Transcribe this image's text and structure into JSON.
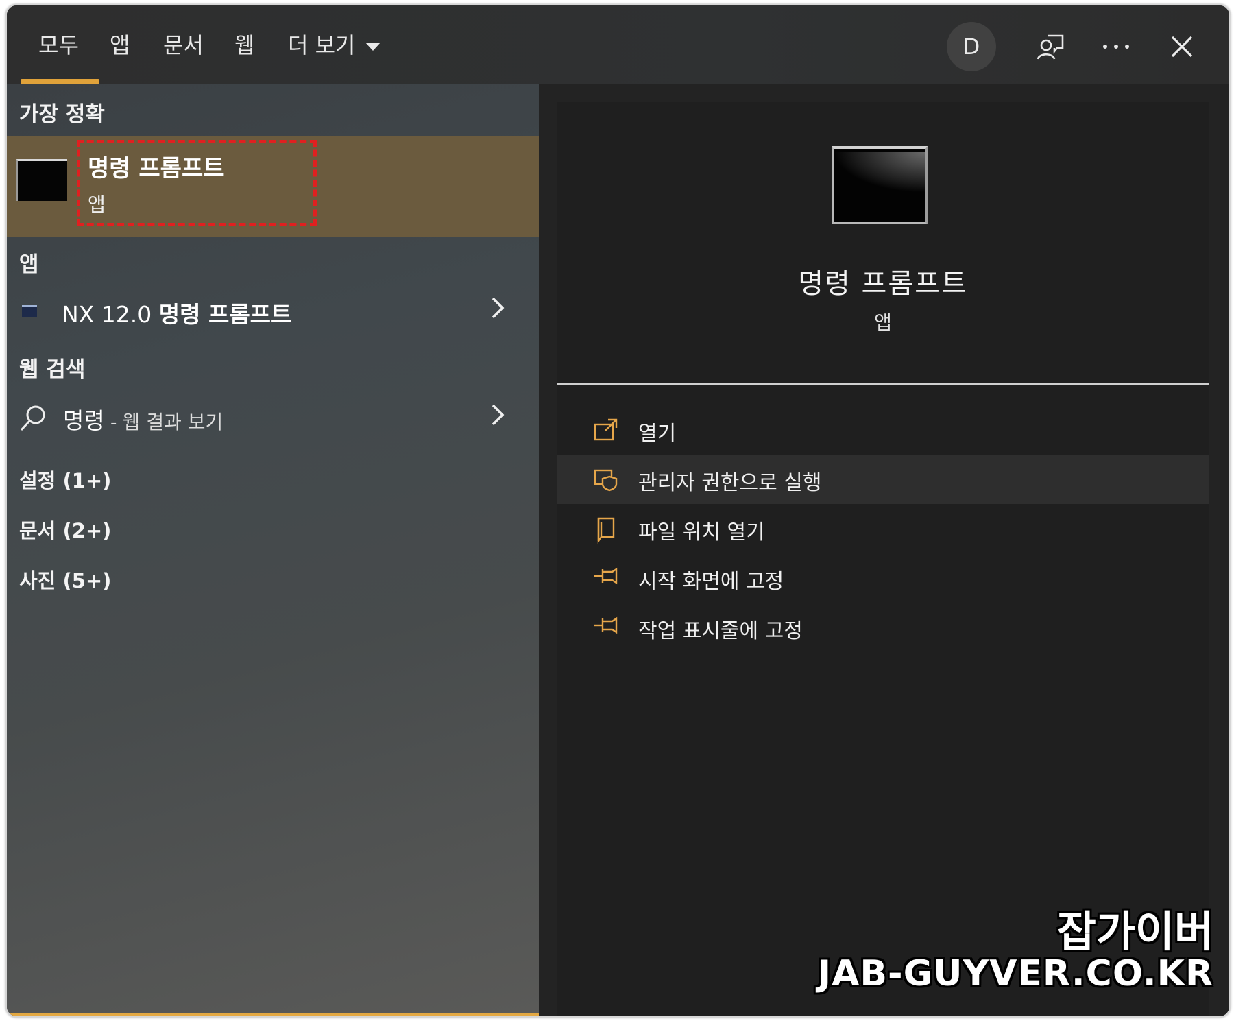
{
  "tabs": {
    "all": "모두",
    "apps": "앱",
    "docs": "문서",
    "web": "웹",
    "more": "더 보기"
  },
  "header": {
    "avatar_letter": "D",
    "feedback_icon": "feedback-person-icon",
    "more_icon": "ellipsis-icon",
    "close_icon": "close-icon",
    "accent_color": "#e0a23a"
  },
  "left": {
    "best_match_heading": "가장 정확",
    "best_match": {
      "title": "명령 프롬프트",
      "subtitle": "앱",
      "highlight_color": "#6b5b3e",
      "annotation_color": "#e02020"
    },
    "apps_heading": "앱",
    "app_item": {
      "prefix": "NX 12.0 ",
      "name": "명령 프롬프트"
    },
    "web_heading": "웹 검색",
    "web_item": {
      "query": "명령",
      "separator": " - ",
      "rest": "웹 결과 보기"
    },
    "categories": [
      "설정 (1+)",
      "문서 (2+)",
      "사진 (5+)"
    ]
  },
  "right": {
    "title": "명령 프롬프트",
    "subtitle": "앱",
    "actions": [
      {
        "label": "열기",
        "icon": "open-icon"
      },
      {
        "label": "관리자 권한으로 실행",
        "icon": "shield-icon"
      },
      {
        "label": "파일 위치 열기",
        "icon": "folder-icon"
      },
      {
        "label": "시작 화면에 고정",
        "icon": "pin-icon"
      },
      {
        "label": "작업 표시줄에 고정",
        "icon": "pin-icon"
      }
    ]
  },
  "watermark": {
    "korean": "잡가이버",
    "url": "JAB-GUYVER.CO.KR"
  }
}
